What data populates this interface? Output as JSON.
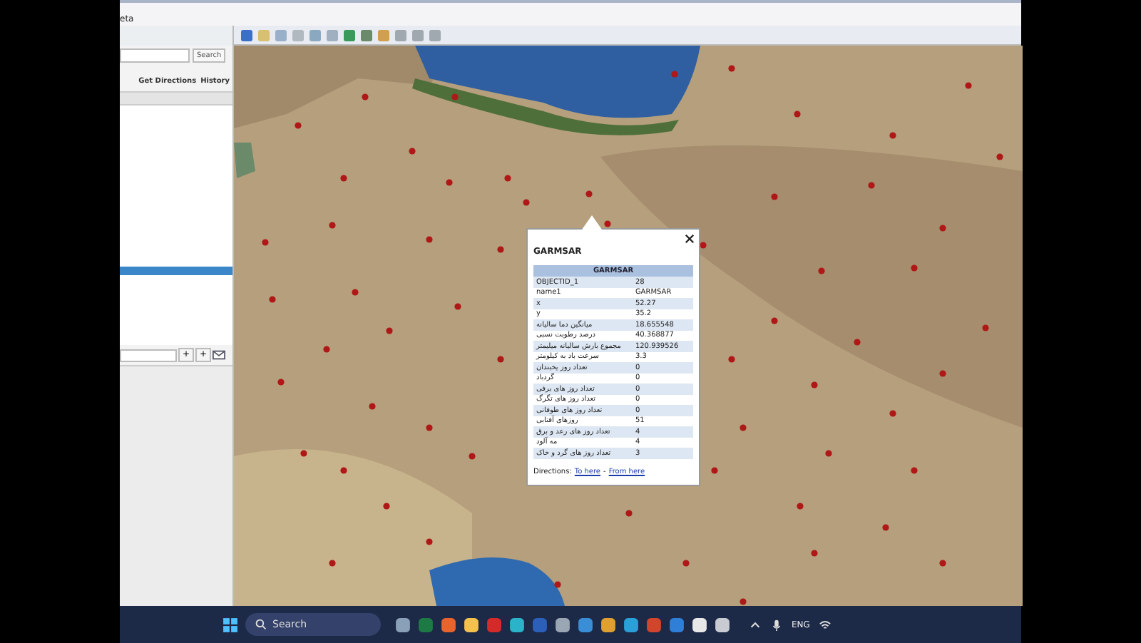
{
  "menu_bar": {
    "label": "eta"
  },
  "sidebar": {
    "search": {
      "button": "Search"
    },
    "directions_link": "Get Directions",
    "history_link": "History",
    "up_button": "+",
    "down_button": "+"
  },
  "popup": {
    "title": "GARMSAR",
    "table_header": "GARMSAR",
    "rows": [
      {
        "label": "OBJECTID_1",
        "value": "28"
      },
      {
        "label": "name1",
        "value": "GARMSAR"
      },
      {
        "label": "x",
        "value": "52.27"
      },
      {
        "label": "y",
        "value": "35.2"
      },
      {
        "label": "میانگین دما سالیانه",
        "value": "18.655548"
      },
      {
        "label": "درصد رطوبت نسبی",
        "value": "40.368877"
      },
      {
        "label": "مجموع بارش سالیانه میلیمتر",
        "value": "120.939526"
      },
      {
        "label": "سرعت باد به کیلومتر",
        "value": "3.3"
      },
      {
        "label": "تعداد روز یخبندان",
        "value": "0"
      },
      {
        "label": "گردباد",
        "value": "0"
      },
      {
        "label": "تعداد روز های برفی",
        "value": "0"
      },
      {
        "label": "تعداد روز های تگرگ",
        "value": "0"
      },
      {
        "label": "تعداد روز های طوفانی",
        "value": "0"
      },
      {
        "label": "روزهای آفتابی",
        "value": "51"
      },
      {
        "label": "تعداد روز های رعد و برق",
        "value": "4"
      },
      {
        "label": "مه آلود",
        "value": "4"
      },
      {
        "label": "تعداد روز های گرد و خاک",
        "value": "3"
      }
    ],
    "directions_label": "Directions:",
    "to_here": "To here",
    "separator": "-",
    "from_here": "From here"
  },
  "taskbar": {
    "search": "Search",
    "language": "ENG"
  }
}
